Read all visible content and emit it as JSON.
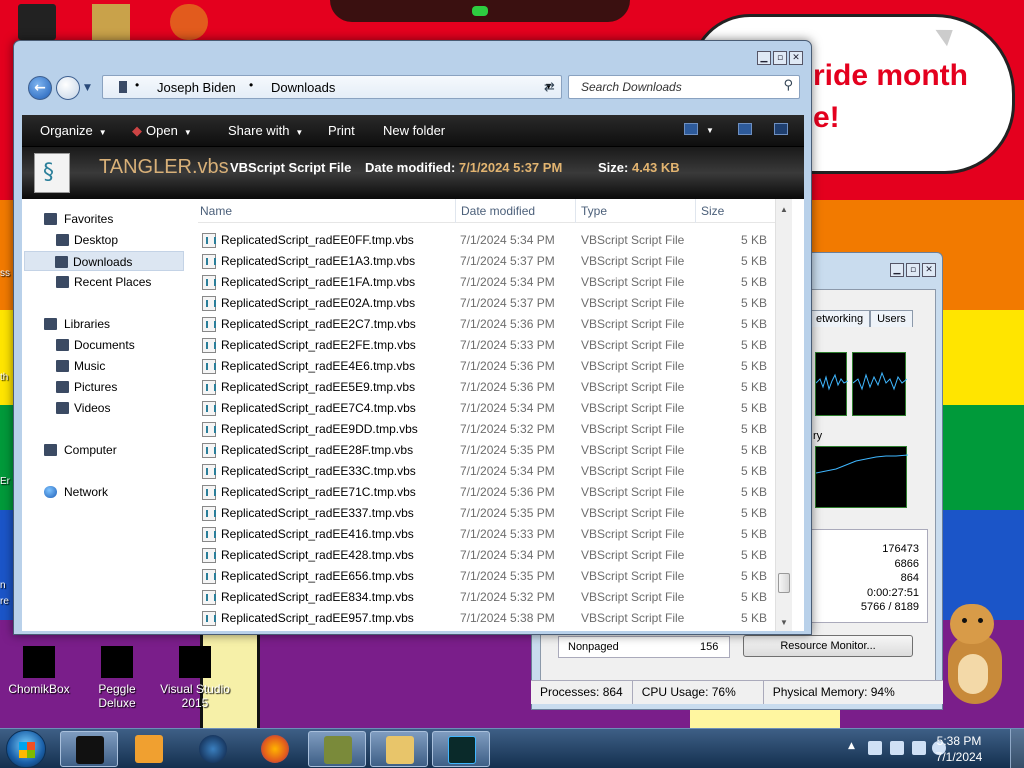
{
  "desktop": {
    "speech_text_line1": "ride month",
    "speech_text_line2": "e!",
    "edge_labels": [
      "ss",
      "th",
      "Er",
      "n",
      "re"
    ],
    "icons": [
      {
        "name": "ChomikBox",
        "label": "ChomikBox"
      },
      {
        "name": "Peggle Deluxe",
        "label": "Peggle Deluxe"
      },
      {
        "name": "Visual Studio 2015",
        "label": "Visual Studio 2015"
      }
    ]
  },
  "explorer": {
    "breadcrumbs": [
      "Joseph Biden",
      "Downloads"
    ],
    "search_placeholder": "Search Downloads",
    "toolbar": {
      "organize": "Organize",
      "open": "Open",
      "share_with": "Share with",
      "print": "Print",
      "new_folder": "New folder"
    },
    "details": {
      "file_name": "TANGLER.vbs",
      "file_type": "VBScript Script File",
      "date_label": "Date modified:",
      "date_value": "7/1/2024 5:37 PM",
      "size_label": "Size:",
      "size_value": "4.43 KB"
    },
    "nav": {
      "favorites": "Favorites",
      "desktop": "Desktop",
      "downloads": "Downloads",
      "recent_places": "Recent Places",
      "libraries": "Libraries",
      "documents": "Documents",
      "music": "Music",
      "pictures": "Pictures",
      "videos": "Videos",
      "computer": "Computer",
      "network": "Network"
    },
    "columns": {
      "name": "Name",
      "date": "Date modified",
      "type": "Type",
      "size": "Size"
    },
    "files": [
      {
        "name": "ReplicatedScript_radEE0FF.tmp.vbs",
        "date": "7/1/2024 5:34 PM",
        "type": "VBScript Script File",
        "size": "5 KB"
      },
      {
        "name": "ReplicatedScript_radEE1A3.tmp.vbs",
        "date": "7/1/2024 5:37 PM",
        "type": "VBScript Script File",
        "size": "5 KB"
      },
      {
        "name": "ReplicatedScript_radEE1FA.tmp.vbs",
        "date": "7/1/2024 5:34 PM",
        "type": "VBScript Script File",
        "size": "5 KB"
      },
      {
        "name": "ReplicatedScript_radEE02A.tmp.vbs",
        "date": "7/1/2024 5:37 PM",
        "type": "VBScript Script File",
        "size": "5 KB"
      },
      {
        "name": "ReplicatedScript_radEE2C7.tmp.vbs",
        "date": "7/1/2024 5:36 PM",
        "type": "VBScript Script File",
        "size": "5 KB"
      },
      {
        "name": "ReplicatedScript_radEE2FE.tmp.vbs",
        "date": "7/1/2024 5:33 PM",
        "type": "VBScript Script File",
        "size": "5 KB"
      },
      {
        "name": "ReplicatedScript_radEE4E6.tmp.vbs",
        "date": "7/1/2024 5:36 PM",
        "type": "VBScript Script File",
        "size": "5 KB"
      },
      {
        "name": "ReplicatedScript_radEE5E9.tmp.vbs",
        "date": "7/1/2024 5:36 PM",
        "type": "VBScript Script File",
        "size": "5 KB"
      },
      {
        "name": "ReplicatedScript_radEE7C4.tmp.vbs",
        "date": "7/1/2024 5:34 PM",
        "type": "VBScript Script File",
        "size": "5 KB"
      },
      {
        "name": "ReplicatedScript_radEE9DD.tmp.vbs",
        "date": "7/1/2024 5:32 PM",
        "type": "VBScript Script File",
        "size": "5 KB"
      },
      {
        "name": "ReplicatedScript_radEE28F.tmp.vbs",
        "date": "7/1/2024 5:35 PM",
        "type": "VBScript Script File",
        "size": "5 KB"
      },
      {
        "name": "ReplicatedScript_radEE33C.tmp.vbs",
        "date": "7/1/2024 5:34 PM",
        "type": "VBScript Script File",
        "size": "5 KB"
      },
      {
        "name": "ReplicatedScript_radEE71C.tmp.vbs",
        "date": "7/1/2024 5:36 PM",
        "type": "VBScript Script File",
        "size": "5 KB"
      },
      {
        "name": "ReplicatedScript_radEE337.tmp.vbs",
        "date": "7/1/2024 5:35 PM",
        "type": "VBScript Script File",
        "size": "5 KB"
      },
      {
        "name": "ReplicatedScript_radEE416.tmp.vbs",
        "date": "7/1/2024 5:33 PM",
        "type": "VBScript Script File",
        "size": "5 KB"
      },
      {
        "name": "ReplicatedScript_radEE428.tmp.vbs",
        "date": "7/1/2024 5:34 PM",
        "type": "VBScript Script File",
        "size": "5 KB"
      },
      {
        "name": "ReplicatedScript_radEE656.tmp.vbs",
        "date": "7/1/2024 5:35 PM",
        "type": "VBScript Script File",
        "size": "5 KB"
      },
      {
        "name": "ReplicatedScript_radEE834.tmp.vbs",
        "date": "7/1/2024 5:32 PM",
        "type": "VBScript Script File",
        "size": "5 KB"
      },
      {
        "name": "ReplicatedScript_radEE957.tmp.vbs",
        "date": "7/1/2024 5:38 PM",
        "type": "VBScript Script File",
        "size": "5 KB"
      }
    ]
  },
  "task_manager": {
    "tabs": [
      "etworking",
      "Users"
    ],
    "memory_label_fragment": "ry",
    "values": [
      "176473",
      "6866",
      "864",
      "0:00:27:51",
      "5766 / 8189"
    ],
    "nonpaged_label": "Nonpaged",
    "nonpaged_value": "156",
    "resource_monitor_button": "Resource Monitor...",
    "status": {
      "processes": "Processes: 864",
      "cpu": "CPU Usage: 76%",
      "memory": "Physical Memory: 94%"
    }
  },
  "taskbar": {
    "time": "5:38 PM",
    "date": "7/1/2024",
    "buttons": [
      "app-window",
      "media-player",
      "chrome-ball",
      "firefox",
      "chomikbox",
      "explorer",
      "task-manager"
    ]
  }
}
